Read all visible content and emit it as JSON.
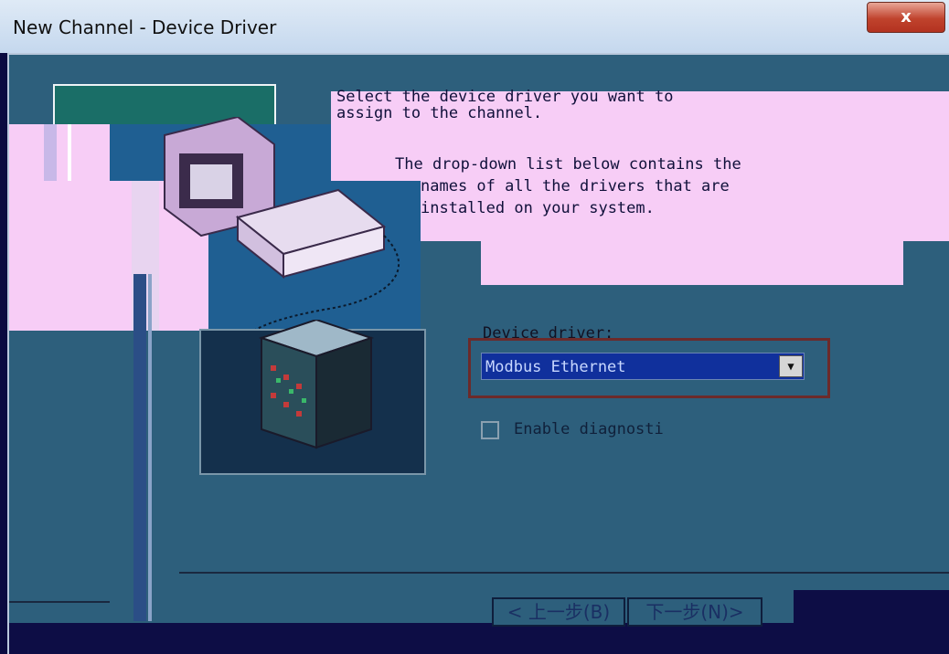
{
  "window": {
    "title": "New Channel - Device Driver",
    "close_label": "x"
  },
  "instructions": {
    "line1": "Select the device driver you want to",
    "line2": "assign to the channel.",
    "line3": "The drop-down list below contains the",
    "line4": "names of all the drivers that are",
    "line5": "installed on your system."
  },
  "driver": {
    "label": "Device driver:",
    "selected": "Modbus Ethernet"
  },
  "diagnostics": {
    "label": "Enable diagnosti"
  },
  "buttons": {
    "back": "< 上一步(B)",
    "next": "下一步(N)>"
  },
  "icons": {
    "close": "close-icon",
    "dropdown": "chevron-down-icon",
    "computer": "computer-icon",
    "server": "server-icon"
  }
}
